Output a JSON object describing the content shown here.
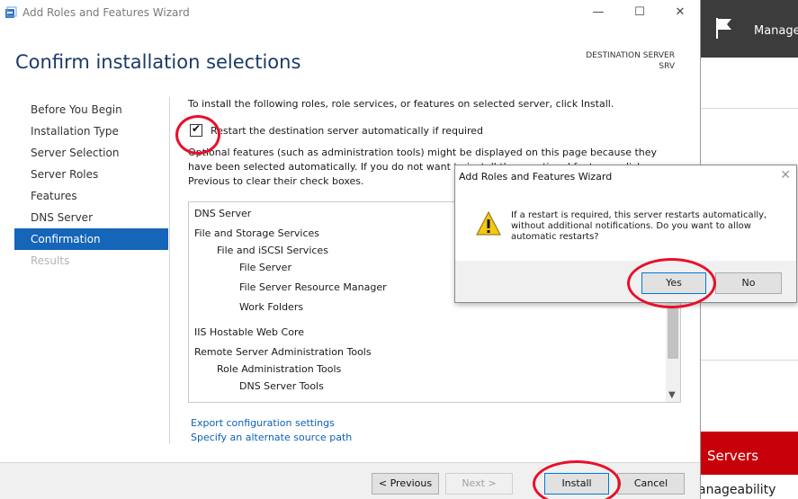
{
  "window": {
    "title": "Add Roles and Features Wizard",
    "minimize_glyph": "—",
    "maximize_glyph": "☐",
    "close_glyph": "✕"
  },
  "heading": "Confirm installation selections",
  "destination": {
    "label": "DESTINATION SERVER",
    "server": "SRV"
  },
  "nav": {
    "items": [
      {
        "label": "Before You Begin",
        "state": "normal"
      },
      {
        "label": "Installation Type",
        "state": "normal"
      },
      {
        "label": "Server Selection",
        "state": "normal"
      },
      {
        "label": "Server Roles",
        "state": "normal"
      },
      {
        "label": "Features",
        "state": "normal"
      },
      {
        "label": "DNS Server",
        "state": "normal"
      },
      {
        "label": "Confirmation",
        "state": "active"
      },
      {
        "label": "Results",
        "state": "disabled"
      }
    ]
  },
  "content": {
    "intro": "To install the following roles, role services, or features on selected server, click Install.",
    "restart_label": "Restart the destination server automatically if required",
    "restart_checked": true,
    "optional_text": "Optional features (such as administration tools) might be displayed on this page because they have been selected automatically. If you do not want to install these optional features, click Previous to clear their check boxes.",
    "features": [
      {
        "label": "DNS Server",
        "indent": 0
      },
      {
        "label": "File and Storage Services",
        "indent": 0
      },
      {
        "label": "File and iSCSI Services",
        "indent": 1
      },
      {
        "label": "File Server",
        "indent": 2
      },
      {
        "label": "File Server Resource Manager",
        "indent": 2
      },
      {
        "label": "Work Folders",
        "indent": 2
      },
      {
        "label": "IIS Hostable Web Core",
        "indent": 0
      },
      {
        "label": "Remote Server Administration Tools",
        "indent": 0
      },
      {
        "label": "Role Administration Tools",
        "indent": 1
      },
      {
        "label": "DNS Server Tools",
        "indent": 2
      }
    ],
    "export_link": "Export configuration settings",
    "alt_source_link": "Specify an alternate source path"
  },
  "footer": {
    "previous": "< Previous",
    "next": "Next >",
    "install": "Install",
    "cancel": "Cancel"
  },
  "dialog": {
    "title": "Add Roles and Features Wizard",
    "message": "If a restart is required, this server restarts automatically, without additional notifications. Do you want to allow automatic restarts?",
    "yes": "Yes",
    "no": "No",
    "close_glyph": "✕",
    "icon": "warning-icon"
  },
  "background": {
    "manage": "Manage",
    "servers": "Servers",
    "manageability": "anageability"
  },
  "colors": {
    "accent": "#1565b8",
    "heading": "#1b3a68",
    "link": "#0b62b8",
    "annotation": "#e8102a",
    "servers_red": "#c8000a"
  }
}
